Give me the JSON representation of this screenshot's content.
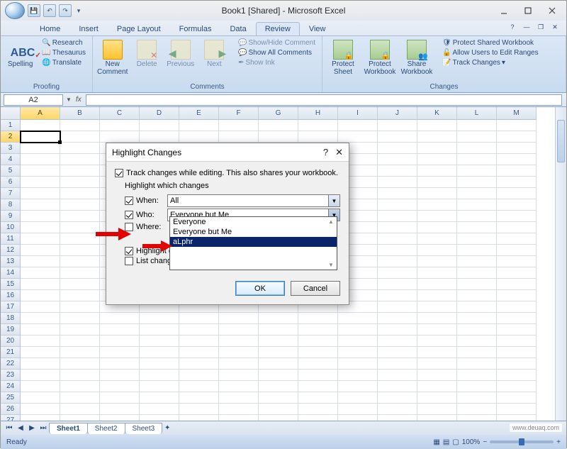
{
  "app": {
    "title": "Book1  [Shared] - Microsoft Excel"
  },
  "qat": {
    "save": "",
    "undo": "",
    "redo": ""
  },
  "tabs": [
    "Home",
    "Insert",
    "Page Layout",
    "Formulas",
    "Data",
    "Review",
    "View"
  ],
  "active_tab": "Review",
  "ribbon": {
    "proofing": {
      "label": "Proofing",
      "spelling": "Spelling",
      "research": "Research",
      "thesaurus": "Thesaurus",
      "translate": "Translate"
    },
    "comments": {
      "label": "Comments",
      "new": "New\nComment",
      "delete": "Delete",
      "previous": "Previous",
      "next": "Next",
      "show_hide": "Show/Hide Comment",
      "show_all": "Show All Comments",
      "show_ink": "Show Ink"
    },
    "changes": {
      "label": "Changes",
      "protect_sheet": "Protect\nSheet",
      "protect_wb": "Protect\nWorkbook",
      "share_wb": "Share\nWorkbook",
      "protect_share": "Protect Shared Workbook",
      "allow_ranges": "Allow Users to Edit Ranges",
      "track_changes": "Track Changes"
    }
  },
  "namebox": {
    "value": "A2"
  },
  "columns": [
    "A",
    "B",
    "C",
    "D",
    "E",
    "F",
    "G",
    "H",
    "I",
    "J",
    "K",
    "L",
    "M"
  ],
  "active_cell": {
    "col": "A",
    "row": 2
  },
  "sheets": {
    "items": [
      "Sheet1",
      "Sheet2",
      "Sheet3"
    ],
    "active": 0
  },
  "status": {
    "text": "Ready",
    "zoom": "100%"
  },
  "dialog": {
    "title": "Highlight Changes",
    "track": "Track changes while editing. This also shares your workbook.",
    "group": "Highlight which changes",
    "when": {
      "label": "When:",
      "value": "All",
      "checked": true
    },
    "who": {
      "label": "Who:",
      "value": "Everyone but Me",
      "checked": true,
      "options": [
        "Everyone",
        "Everyone but Me",
        "aLphr"
      ],
      "selected_index": 2
    },
    "where": {
      "label": "Where:",
      "checked": false
    },
    "highlight_on_screen": {
      "label": "Highlight changes on screen",
      "short": "Highlight c",
      "checked": true
    },
    "list_new_sheet": {
      "label": "List changes on a new sheet",
      "short": "List chang",
      "checked": false
    },
    "ok": "OK",
    "cancel": "Cancel"
  },
  "watermark": "www.deuaq.com"
}
